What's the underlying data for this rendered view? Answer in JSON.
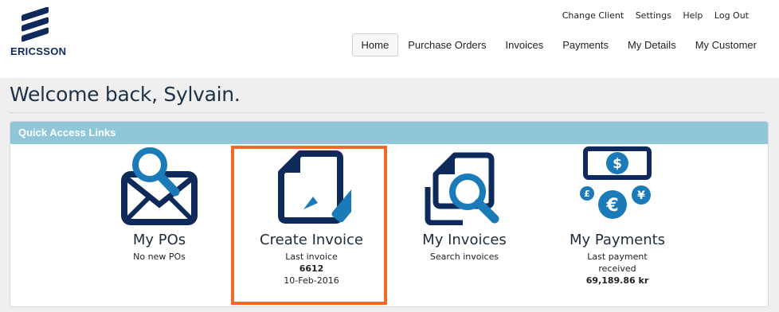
{
  "brand": {
    "name": "ERICSSON"
  },
  "top_links": [
    "Change Client",
    "Settings",
    "Help",
    "Log Out"
  ],
  "nav": {
    "items": [
      {
        "label": "Home",
        "active": true
      },
      {
        "label": "Purchase Orders",
        "active": false
      },
      {
        "label": "Invoices",
        "active": false
      },
      {
        "label": "Payments",
        "active": false
      },
      {
        "label": "My Details",
        "active": false
      },
      {
        "label": "My Customer",
        "active": false
      }
    ]
  },
  "welcome": "Welcome back, Sylvain.",
  "quick_access": {
    "title": "Quick Access Links",
    "tiles": [
      {
        "title": "My POs",
        "line1": "No new POs",
        "icon": "envelope-search-icon"
      },
      {
        "title": "Create Invoice",
        "line1": "Last invoice",
        "line2": "6612",
        "line3": "10-Feb-2016",
        "icon": "document-pen-icon",
        "highlighted": true
      },
      {
        "title": "My Invoices",
        "line1": "Search invoices",
        "icon": "documents-search-icon"
      },
      {
        "title": "My Payments",
        "line1": "Last payment",
        "line2": "received",
        "line3": "69,189.86 kr",
        "icon": "currency-icon"
      }
    ]
  },
  "colors": {
    "navy": "#0e2a5a",
    "accent_blue": "#1a7bb8",
    "panel_header": "#8fc7d9",
    "highlight": "#f26a2b"
  }
}
